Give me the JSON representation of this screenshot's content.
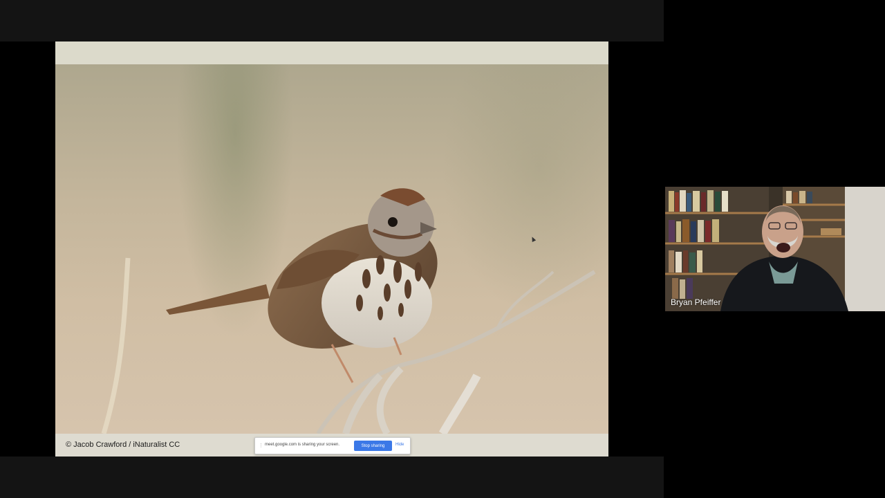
{
  "slide": {
    "credit": "© Jacob Crawford / iNaturalist CC",
    "photo_subject": "song-sparrow-photo"
  },
  "share_bar": {
    "message": "meet.google.com is sharing your screen.",
    "stop_label": "Stop sharing",
    "hide_label": "Hide"
  },
  "participant": {
    "name": "Bryan Pfeiffer"
  },
  "colors": {
    "stop_button": "#3b78e7",
    "background": "#000000",
    "slide_band": "#dcdacb"
  }
}
